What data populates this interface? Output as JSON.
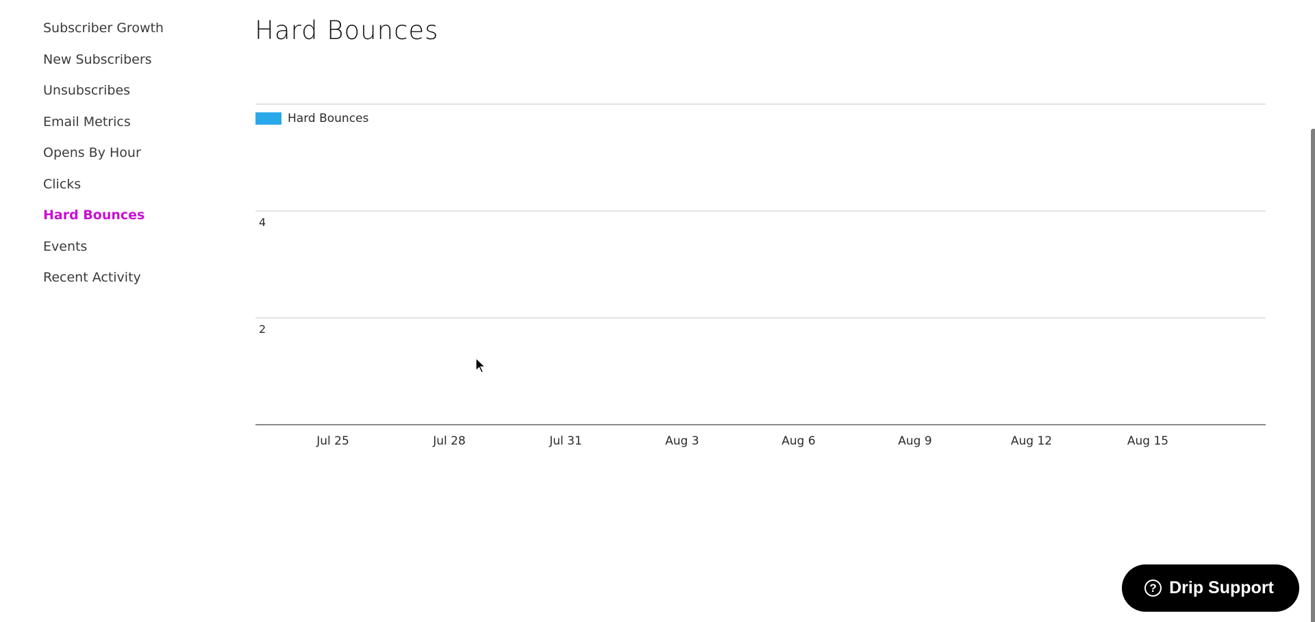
{
  "sidebar": {
    "active_color": "#c90fd4",
    "items": [
      {
        "label": "Subscriber Growth",
        "active": false
      },
      {
        "label": "New Subscribers",
        "active": false
      },
      {
        "label": "Unsubscribes",
        "active": false
      },
      {
        "label": "Email Metrics",
        "active": false
      },
      {
        "label": "Opens By Hour",
        "active": false
      },
      {
        "label": "Clicks",
        "active": false
      },
      {
        "label": "Hard Bounces",
        "active": true
      },
      {
        "label": "Events",
        "active": false
      },
      {
        "label": "Recent Activity",
        "active": false
      }
    ]
  },
  "page": {
    "title": "Hard Bounces"
  },
  "support": {
    "label": "Drip Support",
    "icon": "question-circle-icon"
  },
  "chart_data": {
    "type": "bar",
    "title": "",
    "xlabel": "",
    "ylabel": "",
    "legend": [
      {
        "name": "Hard Bounces",
        "color": "#29a8ea"
      }
    ],
    "legend_position": "top-left",
    "grid": true,
    "ylim": [
      0,
      6
    ],
    "y_ticks": [
      0,
      2,
      4,
      6
    ],
    "y_tick_labels_shown": [
      "4",
      "2"
    ],
    "x_range": [
      "Jul 22",
      "Aug 18"
    ],
    "x_tick_labels": [
      "Jul 25",
      "Jul 28",
      "Jul 31",
      "Aug 3",
      "Aug 6",
      "Aug 9",
      "Aug 12",
      "Aug 15"
    ],
    "series": [
      {
        "name": "Hard Bounces",
        "values": []
      }
    ]
  }
}
